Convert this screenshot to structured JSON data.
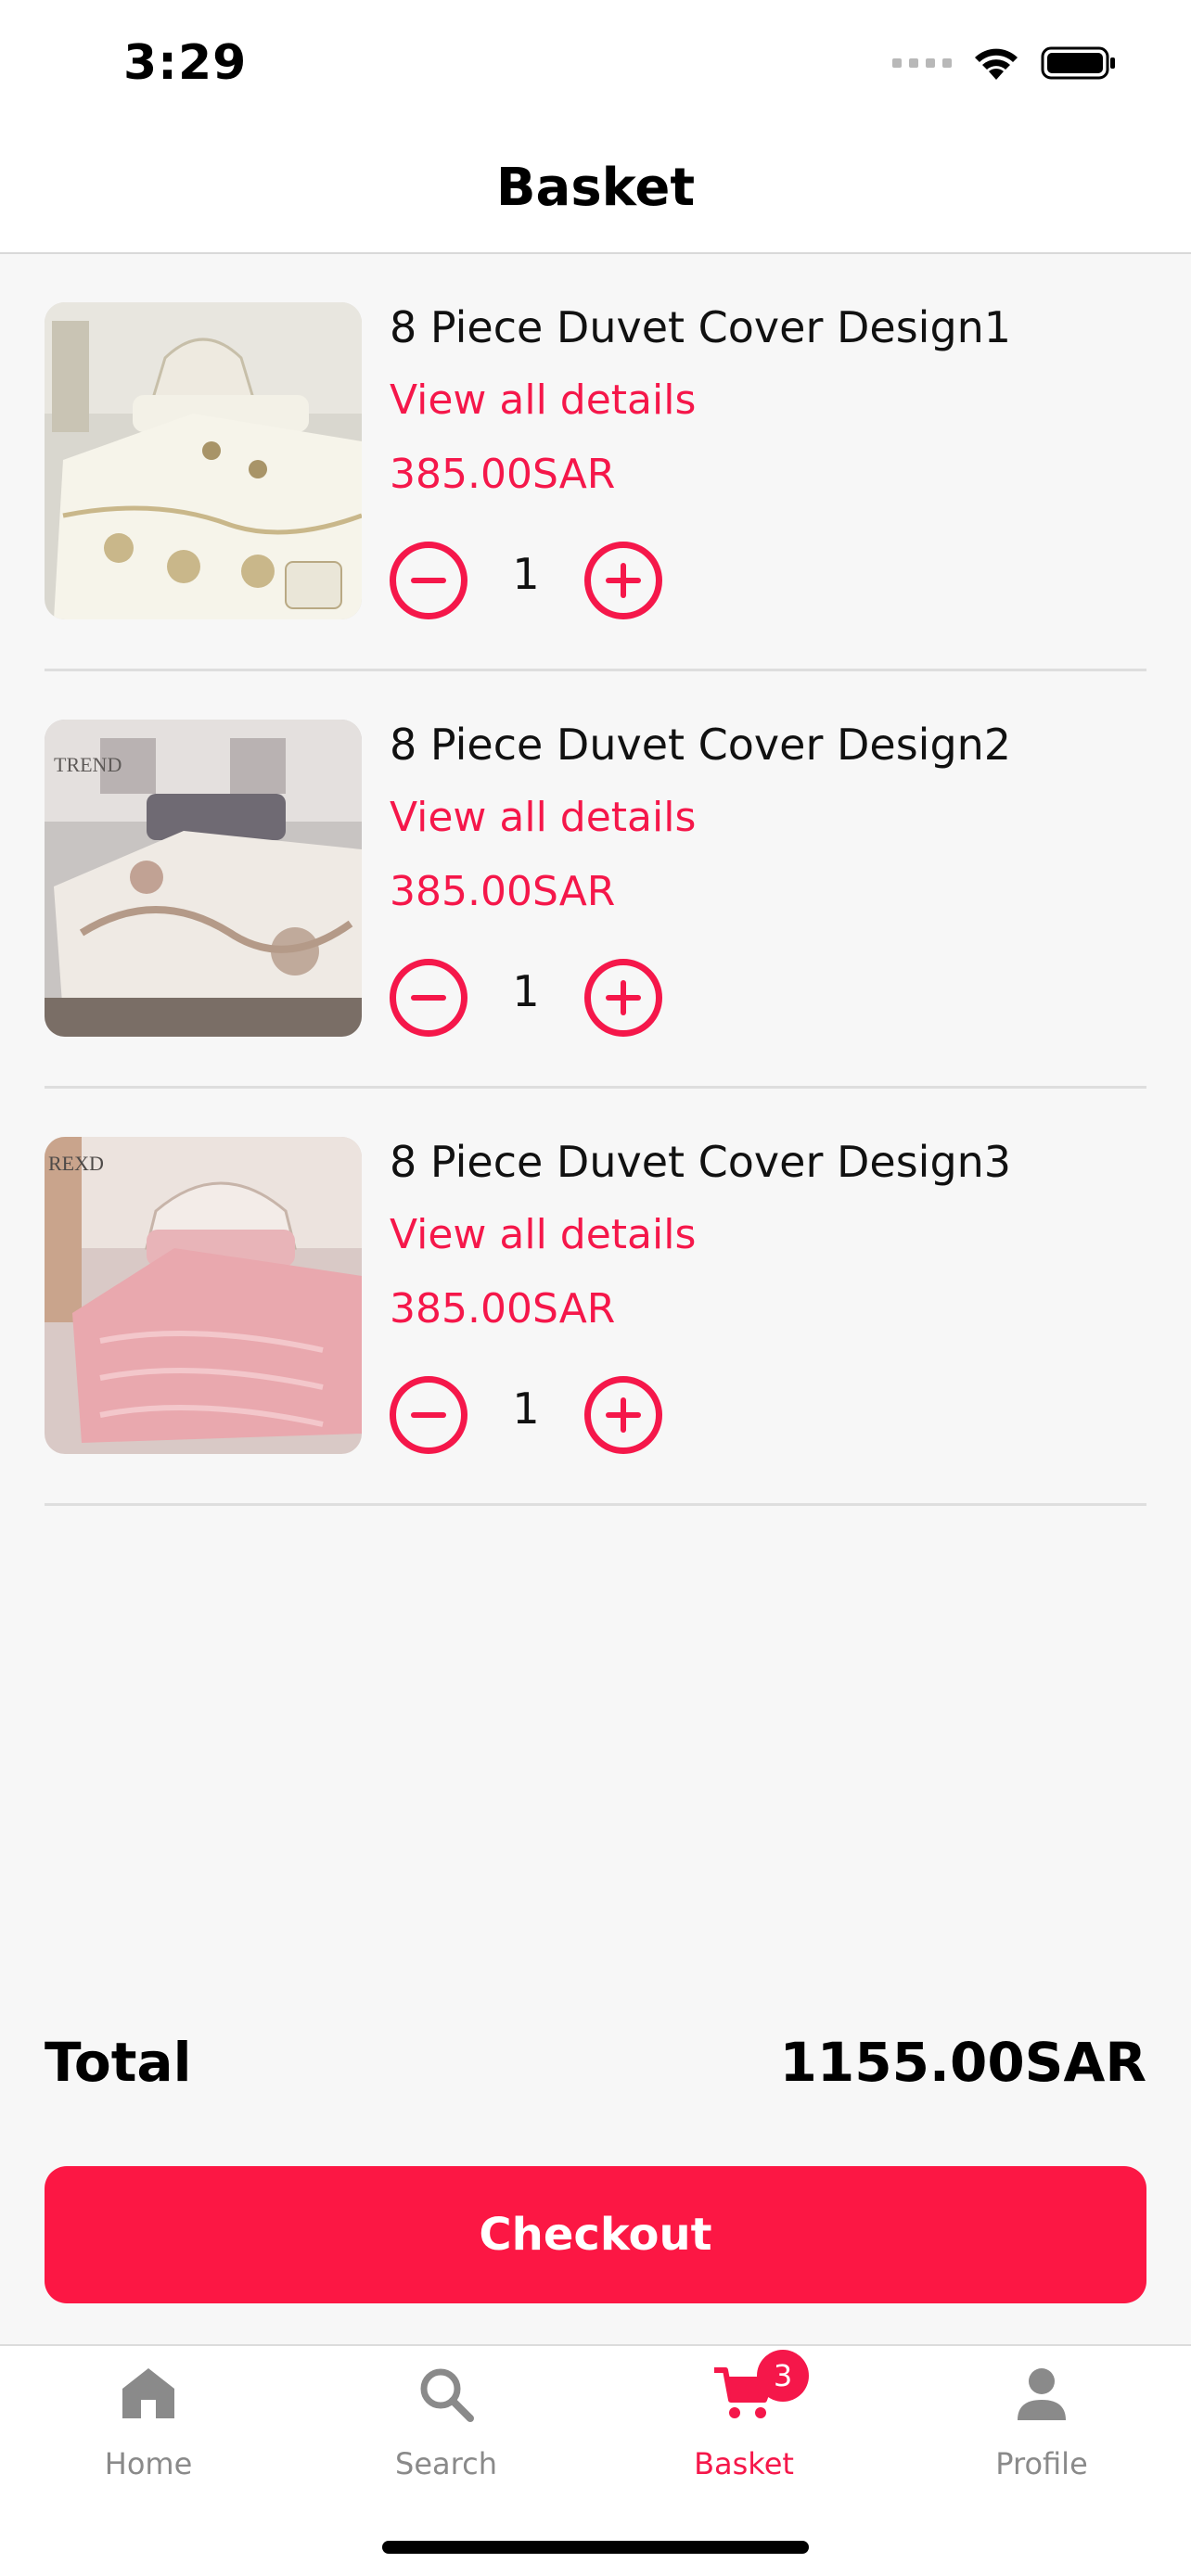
{
  "status_bar": {
    "time": "3:29",
    "icons": [
      "signal-icon",
      "wifi-icon",
      "battery-icon"
    ]
  },
  "header": {
    "title": "Basket"
  },
  "basket": {
    "items": [
      {
        "name": "8 Piece Duvet Cover Design1",
        "details_link": "View all details",
        "price": "385.00SAR",
        "quantity": "1",
        "image": "white-duvet-bedroom-photo"
      },
      {
        "name": "8 Piece Duvet Cover Design2",
        "details_link": "View all details",
        "price": "385.00SAR",
        "quantity": "1",
        "image": "grey-duvet-bedroom-photo",
        "image_logo": "TREND"
      },
      {
        "name": "8 Piece Duvet Cover Design3",
        "details_link": "View all details",
        "price": "385.00SAR",
        "quantity": "1",
        "image": "pink-duvet-bedroom-photo",
        "image_logo": "REXD"
      }
    ]
  },
  "summary": {
    "total_label": "Total",
    "total_value": "1155.00SAR"
  },
  "checkout": {
    "label": "Checkout"
  },
  "tab_bar": {
    "tabs": [
      {
        "label": "Home",
        "icon": "home-icon",
        "active": false
      },
      {
        "label": "Search",
        "icon": "search-icon",
        "active": false
      },
      {
        "label": "Basket",
        "icon": "cart-icon",
        "active": true,
        "badge": "3"
      },
      {
        "label": "Profile",
        "icon": "person-icon",
        "active": false
      }
    ]
  },
  "colors": {
    "accent": "#f5174a",
    "checkout": "#fc1744",
    "background": "#f7f7f7",
    "inactive": "#8a8a8a"
  }
}
